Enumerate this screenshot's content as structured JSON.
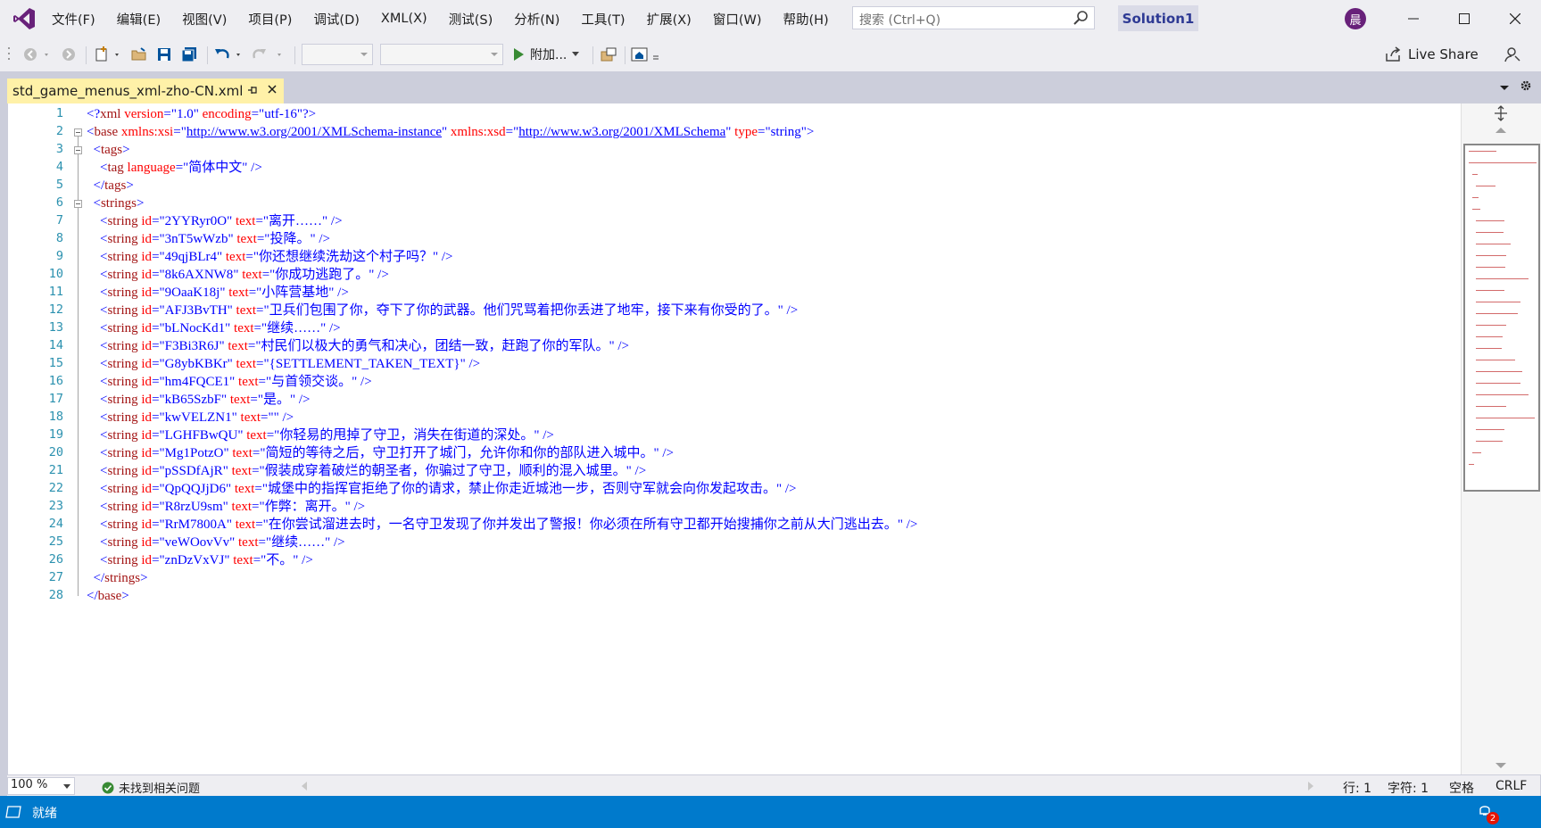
{
  "menu": [
    "文件(F)",
    "编辑(E)",
    "视图(V)",
    "项目(P)",
    "调试(D)",
    "XML(X)",
    "测试(S)",
    "分析(N)",
    "工具(T)",
    "扩展(X)",
    "窗口(W)",
    "帮助(H)"
  ],
  "search": {
    "placeholder": "搜索 (Ctrl+Q)"
  },
  "solution_name": "Solution1",
  "user_initial": "晨",
  "toolbar": {
    "attach_label": "附加...",
    "live_share": "Live Share"
  },
  "tab": {
    "filename": "std_game_menus_xml-zho-CN.xml"
  },
  "code_lines": [
    [
      [
        "b",
        "<?"
      ],
      [
        "e",
        "xml"
      ],
      [
        "x",
        " "
      ],
      [
        "a",
        "version"
      ],
      [
        "b",
        "=\""
      ],
      [
        "v",
        "1.0"
      ],
      [
        "b",
        "\""
      ],
      [
        "x",
        " "
      ],
      [
        "a",
        "encoding"
      ],
      [
        "b",
        "=\""
      ],
      [
        "v",
        "utf-16"
      ],
      [
        "b",
        "\"?>"
      ]
    ],
    [
      [
        "b",
        "<"
      ],
      [
        "e",
        "base"
      ],
      [
        "x",
        " "
      ],
      [
        "a",
        "xmlns:xsi"
      ],
      [
        "b",
        "=\""
      ],
      [
        "u",
        "http://www.w3.org/2001/XMLSchema-instance"
      ],
      [
        "b",
        "\""
      ],
      [
        "x",
        " "
      ],
      [
        "a",
        "xmlns:xsd"
      ],
      [
        "b",
        "=\""
      ],
      [
        "u",
        "http://www.w3.org/2001/XMLSchema"
      ],
      [
        "b",
        "\""
      ],
      [
        "x",
        " "
      ],
      [
        "a",
        "type"
      ],
      [
        "b",
        "=\""
      ],
      [
        "v",
        "string"
      ],
      [
        "b",
        "\">"
      ]
    ],
    [
      [
        "x",
        "  "
      ],
      [
        "b",
        "<"
      ],
      [
        "e",
        "tags"
      ],
      [
        "b",
        ">"
      ]
    ],
    [
      [
        "x",
        "    "
      ],
      [
        "b",
        "<"
      ],
      [
        "e",
        "tag"
      ],
      [
        "x",
        " "
      ],
      [
        "a",
        "language"
      ],
      [
        "b",
        "=\""
      ],
      [
        "v",
        "简体中文"
      ],
      [
        "b",
        "\""
      ],
      [
        "x",
        " "
      ],
      [
        "b",
        "/>"
      ]
    ],
    [
      [
        "x",
        "  "
      ],
      [
        "b",
        "</"
      ],
      [
        "e",
        "tags"
      ],
      [
        "b",
        ">"
      ]
    ],
    [
      [
        "x",
        "  "
      ],
      [
        "b",
        "<"
      ],
      [
        "e",
        "strings"
      ],
      [
        "b",
        ">"
      ]
    ],
    [
      [
        "x",
        "    "
      ],
      [
        "b",
        "<"
      ],
      [
        "e",
        "string"
      ],
      [
        "x",
        " "
      ],
      [
        "a",
        "id"
      ],
      [
        "b",
        "=\""
      ],
      [
        "v",
        "2YYRyr0O"
      ],
      [
        "b",
        "\""
      ],
      [
        "x",
        " "
      ],
      [
        "a",
        "text"
      ],
      [
        "b",
        "=\""
      ],
      [
        "v",
        "离开……"
      ],
      [
        "b",
        "\""
      ],
      [
        "x",
        " "
      ],
      [
        "b",
        "/>"
      ]
    ],
    [
      [
        "x",
        "    "
      ],
      [
        "b",
        "<"
      ],
      [
        "e",
        "string"
      ],
      [
        "x",
        " "
      ],
      [
        "a",
        "id"
      ],
      [
        "b",
        "=\""
      ],
      [
        "v",
        "3nT5wWzb"
      ],
      [
        "b",
        "\""
      ],
      [
        "x",
        " "
      ],
      [
        "a",
        "text"
      ],
      [
        "b",
        "=\""
      ],
      [
        "v",
        "投降。"
      ],
      [
        "b",
        "\""
      ],
      [
        "x",
        " "
      ],
      [
        "b",
        "/>"
      ]
    ],
    [
      [
        "x",
        "    "
      ],
      [
        "b",
        "<"
      ],
      [
        "e",
        "string"
      ],
      [
        "x",
        " "
      ],
      [
        "a",
        "id"
      ],
      [
        "b",
        "=\""
      ],
      [
        "v",
        "49qjBLr4"
      ],
      [
        "b",
        "\""
      ],
      [
        "x",
        " "
      ],
      [
        "a",
        "text"
      ],
      [
        "b",
        "=\""
      ],
      [
        "v",
        "你还想继续洗劫这个村子吗？"
      ],
      [
        "b",
        "\""
      ],
      [
        "x",
        " "
      ],
      [
        "b",
        "/>"
      ]
    ],
    [
      [
        "x",
        "    "
      ],
      [
        "b",
        "<"
      ],
      [
        "e",
        "string"
      ],
      [
        "x",
        " "
      ],
      [
        "a",
        "id"
      ],
      [
        "b",
        "=\""
      ],
      [
        "v",
        "8k6AXNW8"
      ],
      [
        "b",
        "\""
      ],
      [
        "x",
        " "
      ],
      [
        "a",
        "text"
      ],
      [
        "b",
        "=\""
      ],
      [
        "v",
        "你成功逃跑了。"
      ],
      [
        "b",
        "\""
      ],
      [
        "x",
        " "
      ],
      [
        "b",
        "/>"
      ]
    ],
    [
      [
        "x",
        "    "
      ],
      [
        "b",
        "<"
      ],
      [
        "e",
        "string"
      ],
      [
        "x",
        " "
      ],
      [
        "a",
        "id"
      ],
      [
        "b",
        "=\""
      ],
      [
        "v",
        "9OaaK18j"
      ],
      [
        "b",
        "\""
      ],
      [
        "x",
        " "
      ],
      [
        "a",
        "text"
      ],
      [
        "b",
        "=\""
      ],
      [
        "v",
        "小阵营基地"
      ],
      [
        "b",
        "\""
      ],
      [
        "x",
        " "
      ],
      [
        "b",
        "/>"
      ]
    ],
    [
      [
        "x",
        "    "
      ],
      [
        "b",
        "<"
      ],
      [
        "e",
        "string"
      ],
      [
        "x",
        " "
      ],
      [
        "a",
        "id"
      ],
      [
        "b",
        "=\""
      ],
      [
        "v",
        "AFJ3BvTH"
      ],
      [
        "b",
        "\""
      ],
      [
        "x",
        " "
      ],
      [
        "a",
        "text"
      ],
      [
        "b",
        "=\""
      ],
      [
        "v",
        "卫兵们包围了你，夺下了你的武器。他们咒骂着把你丢进了地牢，接下来有你受的了。"
      ],
      [
        "b",
        "\""
      ],
      [
        "x",
        " "
      ],
      [
        "b",
        "/>"
      ]
    ],
    [
      [
        "x",
        "    "
      ],
      [
        "b",
        "<"
      ],
      [
        "e",
        "string"
      ],
      [
        "x",
        " "
      ],
      [
        "a",
        "id"
      ],
      [
        "b",
        "=\""
      ],
      [
        "v",
        "bLNocKd1"
      ],
      [
        "b",
        "\""
      ],
      [
        "x",
        " "
      ],
      [
        "a",
        "text"
      ],
      [
        "b",
        "=\""
      ],
      [
        "v",
        "继续……"
      ],
      [
        "b",
        "\""
      ],
      [
        "x",
        " "
      ],
      [
        "b",
        "/>"
      ]
    ],
    [
      [
        "x",
        "    "
      ],
      [
        "b",
        "<"
      ],
      [
        "e",
        "string"
      ],
      [
        "x",
        " "
      ],
      [
        "a",
        "id"
      ],
      [
        "b",
        "=\""
      ],
      [
        "v",
        "F3Bi3R6J"
      ],
      [
        "b",
        "\""
      ],
      [
        "x",
        " "
      ],
      [
        "a",
        "text"
      ],
      [
        "b",
        "=\""
      ],
      [
        "v",
        "村民们以极大的勇气和决心，团结一致，赶跑了你的军队。"
      ],
      [
        "b",
        "\""
      ],
      [
        "x",
        " "
      ],
      [
        "b",
        "/>"
      ]
    ],
    [
      [
        "x",
        "    "
      ],
      [
        "b",
        "<"
      ],
      [
        "e",
        "string"
      ],
      [
        "x",
        " "
      ],
      [
        "a",
        "id"
      ],
      [
        "b",
        "=\""
      ],
      [
        "v",
        "G8ybKBKr"
      ],
      [
        "b",
        "\""
      ],
      [
        "x",
        " "
      ],
      [
        "a",
        "text"
      ],
      [
        "b",
        "=\""
      ],
      [
        "v",
        "{SETTLEMENT_TAKEN_TEXT}"
      ],
      [
        "b",
        "\""
      ],
      [
        "x",
        " "
      ],
      [
        "b",
        "/>"
      ]
    ],
    [
      [
        "x",
        "    "
      ],
      [
        "b",
        "<"
      ],
      [
        "e",
        "string"
      ],
      [
        "x",
        " "
      ],
      [
        "a",
        "id"
      ],
      [
        "b",
        "=\""
      ],
      [
        "v",
        "hm4FQCE1"
      ],
      [
        "b",
        "\""
      ],
      [
        "x",
        " "
      ],
      [
        "a",
        "text"
      ],
      [
        "b",
        "=\""
      ],
      [
        "v",
        "与首领交谈。"
      ],
      [
        "b",
        "\""
      ],
      [
        "x",
        " "
      ],
      [
        "b",
        "/>"
      ]
    ],
    [
      [
        "x",
        "    "
      ],
      [
        "b",
        "<"
      ],
      [
        "e",
        "string"
      ],
      [
        "x",
        " "
      ],
      [
        "a",
        "id"
      ],
      [
        "b",
        "=\""
      ],
      [
        "v",
        "kB65SzbF"
      ],
      [
        "b",
        "\""
      ],
      [
        "x",
        " "
      ],
      [
        "a",
        "text"
      ],
      [
        "b",
        "=\""
      ],
      [
        "v",
        "是。"
      ],
      [
        "b",
        "\""
      ],
      [
        "x",
        " "
      ],
      [
        "b",
        "/>"
      ]
    ],
    [
      [
        "x",
        "    "
      ],
      [
        "b",
        "<"
      ],
      [
        "e",
        "string"
      ],
      [
        "x",
        " "
      ],
      [
        "a",
        "id"
      ],
      [
        "b",
        "=\""
      ],
      [
        "v",
        "kwVELZN1"
      ],
      [
        "b",
        "\""
      ],
      [
        "x",
        " "
      ],
      [
        "a",
        "text"
      ],
      [
        "b",
        "=\"\""
      ],
      [
        "x",
        " "
      ],
      [
        "b",
        "/>"
      ]
    ],
    [
      [
        "x",
        "    "
      ],
      [
        "b",
        "<"
      ],
      [
        "e",
        "string"
      ],
      [
        "x",
        " "
      ],
      [
        "a",
        "id"
      ],
      [
        "b",
        "=\""
      ],
      [
        "v",
        "LGHFBwQU"
      ],
      [
        "b",
        "\""
      ],
      [
        "x",
        " "
      ],
      [
        "a",
        "text"
      ],
      [
        "b",
        "=\""
      ],
      [
        "v",
        "你轻易的甩掉了守卫，消失在街道的深处。"
      ],
      [
        "b",
        "\""
      ],
      [
        "x",
        " "
      ],
      [
        "b",
        "/>"
      ]
    ],
    [
      [
        "x",
        "    "
      ],
      [
        "b",
        "<"
      ],
      [
        "e",
        "string"
      ],
      [
        "x",
        " "
      ],
      [
        "a",
        "id"
      ],
      [
        "b",
        "=\""
      ],
      [
        "v",
        "Mg1PotzO"
      ],
      [
        "b",
        "\""
      ],
      [
        "x",
        " "
      ],
      [
        "a",
        "text"
      ],
      [
        "b",
        "=\""
      ],
      [
        "v",
        "简短的等待之后，守卫打开了城门，允许你和你的部队进入城中。"
      ],
      [
        "b",
        "\""
      ],
      [
        "x",
        " "
      ],
      [
        "b",
        "/>"
      ]
    ],
    [
      [
        "x",
        "    "
      ],
      [
        "b",
        "<"
      ],
      [
        "e",
        "string"
      ],
      [
        "x",
        " "
      ],
      [
        "a",
        "id"
      ],
      [
        "b",
        "=\""
      ],
      [
        "v",
        "pSSDfAjR"
      ],
      [
        "b",
        "\""
      ],
      [
        "x",
        " "
      ],
      [
        "a",
        "text"
      ],
      [
        "b",
        "=\""
      ],
      [
        "v",
        "假装成穿着破烂的朝圣者，你骗过了守卫，顺利的混入城里。"
      ],
      [
        "b",
        "\""
      ],
      [
        "x",
        " "
      ],
      [
        "b",
        "/>"
      ]
    ],
    [
      [
        "x",
        "    "
      ],
      [
        "b",
        "<"
      ],
      [
        "e",
        "string"
      ],
      [
        "x",
        " "
      ],
      [
        "a",
        "id"
      ],
      [
        "b",
        "=\""
      ],
      [
        "v",
        "QpQQJjD6"
      ],
      [
        "b",
        "\""
      ],
      [
        "x",
        " "
      ],
      [
        "a",
        "text"
      ],
      [
        "b",
        "=\""
      ],
      [
        "v",
        "城堡中的指挥官拒绝了你的请求，禁止你走近城池一步，否则守军就会向你发起攻击。"
      ],
      [
        "b",
        "\""
      ],
      [
        "x",
        " "
      ],
      [
        "b",
        "/>"
      ]
    ],
    [
      [
        "x",
        "    "
      ],
      [
        "b",
        "<"
      ],
      [
        "e",
        "string"
      ],
      [
        "x",
        " "
      ],
      [
        "a",
        "id"
      ],
      [
        "b",
        "=\""
      ],
      [
        "v",
        "R8rzU9sm"
      ],
      [
        "b",
        "\""
      ],
      [
        "x",
        " "
      ],
      [
        "a",
        "text"
      ],
      [
        "b",
        "=\""
      ],
      [
        "v",
        "作弊：离开。"
      ],
      [
        "b",
        "\""
      ],
      [
        "x",
        " "
      ],
      [
        "b",
        "/>"
      ]
    ],
    [
      [
        "x",
        "    "
      ],
      [
        "b",
        "<"
      ],
      [
        "e",
        "string"
      ],
      [
        "x",
        " "
      ],
      [
        "a",
        "id"
      ],
      [
        "b",
        "=\""
      ],
      [
        "v",
        "RrM7800A"
      ],
      [
        "b",
        "\""
      ],
      [
        "x",
        " "
      ],
      [
        "a",
        "text"
      ],
      [
        "b",
        "=\""
      ],
      [
        "v",
        "在你尝试溜进去时，一名守卫发现了你并发出了警报！你必须在所有守卫都开始搜捕你之前从大门逃出去。"
      ],
      [
        "b",
        "\""
      ],
      [
        "x",
        " "
      ],
      [
        "b",
        "/>"
      ]
    ],
    [
      [
        "x",
        "    "
      ],
      [
        "b",
        "<"
      ],
      [
        "e",
        "string"
      ],
      [
        "x",
        " "
      ],
      [
        "a",
        "id"
      ],
      [
        "b",
        "=\""
      ],
      [
        "v",
        "veWOovVv"
      ],
      [
        "b",
        "\""
      ],
      [
        "x",
        " "
      ],
      [
        "a",
        "text"
      ],
      [
        "b",
        "=\""
      ],
      [
        "v",
        "继续……"
      ],
      [
        "b",
        "\""
      ],
      [
        "x",
        " "
      ],
      [
        "b",
        "/>"
      ]
    ],
    [
      [
        "x",
        "    "
      ],
      [
        "b",
        "<"
      ],
      [
        "e",
        "string"
      ],
      [
        "x",
        " "
      ],
      [
        "a",
        "id"
      ],
      [
        "b",
        "=\""
      ],
      [
        "v",
        "znDzVxVJ"
      ],
      [
        "b",
        "\""
      ],
      [
        "x",
        " "
      ],
      [
        "a",
        "text"
      ],
      [
        "b",
        "=\""
      ],
      [
        "v",
        "不。"
      ],
      [
        "b",
        "\""
      ],
      [
        "x",
        " "
      ],
      [
        "b",
        "/>"
      ]
    ],
    [
      [
        "x",
        "  "
      ],
      [
        "b",
        "</"
      ],
      [
        "e",
        "strings"
      ],
      [
        "b",
        ">"
      ]
    ],
    [
      [
        "b",
        "</"
      ],
      [
        "e",
        "base"
      ],
      [
        "b",
        ">"
      ]
    ]
  ],
  "status": {
    "zoom": "100 %",
    "issues": "未找到相关问题",
    "line": "行: 1",
    "col": "字符: 1",
    "indent": "空格",
    "eol": "CRLF",
    "ready": "就绪",
    "notifications": "2"
  },
  "colors": {
    "accent": "#007acc",
    "tab": "#fff1a8",
    "line_number": "#2b91af",
    "element": "#a31515",
    "attribute": "#ff0000",
    "value": "#0000ff"
  }
}
